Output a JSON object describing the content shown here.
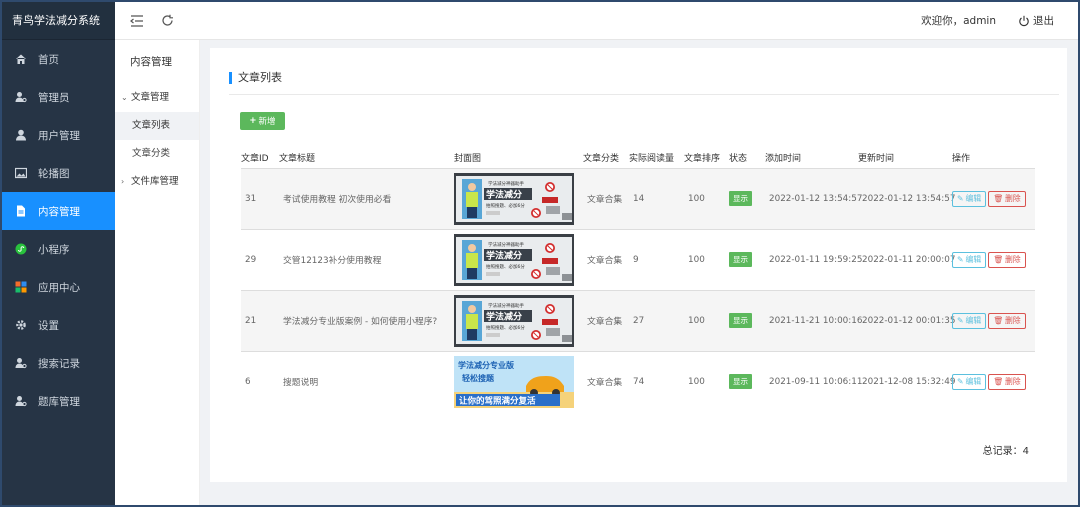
{
  "app": {
    "title": "青鸟学法减分系统"
  },
  "sidebar": {
    "items": [
      {
        "label": "首页",
        "icon": "home-icon",
        "active": false
      },
      {
        "label": "管理员",
        "icon": "user-gear-icon",
        "active": false
      },
      {
        "label": "用户管理",
        "icon": "user-icon",
        "active": false
      },
      {
        "label": "轮播图",
        "icon": "image-icon",
        "active": false
      },
      {
        "label": "内容管理",
        "icon": "document-icon",
        "active": true
      },
      {
        "label": "小程序",
        "icon": "miniprogram-icon",
        "active": false
      },
      {
        "label": "应用中心",
        "icon": "apps-grid-icon",
        "active": false
      },
      {
        "label": "设置",
        "icon": "gear-icon",
        "active": false
      },
      {
        "label": "搜索记录",
        "icon": "user-gear-icon",
        "active": false
      },
      {
        "label": "题库管理",
        "icon": "user-gear-icon",
        "active": false
      }
    ]
  },
  "topbar": {
    "welcome": "欢迎你，admin",
    "logout": "退出"
  },
  "subnav": {
    "title": "内容管理",
    "group_article": "文章管理",
    "item_list": "文章列表",
    "item_category": "文章分类",
    "group_files": "文件库管理"
  },
  "main": {
    "title": "文章列表",
    "add_label": "新增",
    "columns": [
      "文章ID",
      "文章标题",
      "封面图",
      "文章分类",
      "实际阅读量",
      "文章排序",
      "状态",
      "添加时间",
      "更新时间",
      "操作"
    ],
    "rows": [
      {
        "id": "31",
        "title": "考试使用教程 初次使用必看",
        "cover": "cover-police",
        "category": "文章合集",
        "views": "14",
        "sort": "100",
        "status": "显示",
        "created": "2022-01-12 13:54:57",
        "updated": "2022-01-12 13:54:57"
      },
      {
        "id": "29",
        "title": "交管12123补分使用教程",
        "cover": "cover-police",
        "category": "文章合集",
        "views": "9",
        "sort": "100",
        "status": "显示",
        "created": "2022-01-11 19:59:25",
        "updated": "2022-01-11 20:00:07"
      },
      {
        "id": "21",
        "title": "学法减分专业版案例 - 如何使用小程序?",
        "cover": "cover-police",
        "category": "文章合集",
        "views": "27",
        "sort": "100",
        "status": "显示",
        "created": "2021-11-21 10:00:16",
        "updated": "2022-01-12 00:01:35"
      },
      {
        "id": "6",
        "title": "搜题说明",
        "cover": "cover-car",
        "category": "文章合集",
        "views": "74",
        "sort": "100",
        "status": "显示",
        "created": "2021-09-11 10:06:11",
        "updated": "2021-12-08 15:32:49"
      }
    ],
    "edit_label": "编辑",
    "delete_label": "删除",
    "total": "总记录：4"
  },
  "covers": {
    "police": {
      "top": "学法减分神器助手",
      "big": "学法减分",
      "sub": "拍照搜题、必加6分"
    },
    "car": {
      "line1": "学法减分专业版",
      "line2": "轻松搜题",
      "line3": "让你的驾照满分复活"
    }
  },
  "colors": {
    "sidebar": "#263445",
    "active": "#1890ff",
    "success": "#5cb85c",
    "info": "#5bc0de",
    "danger": "#d9534f"
  }
}
